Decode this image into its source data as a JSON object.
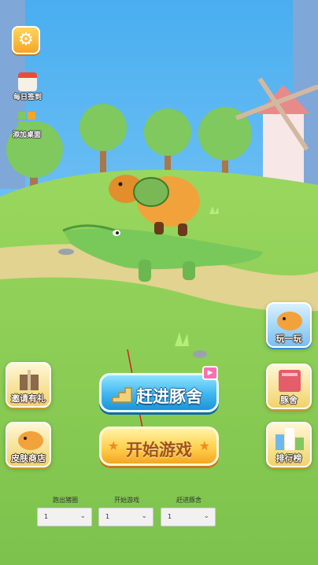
{
  "top_left": {
    "settings_icon": "gear-icon",
    "daily_checkin_label": "每日签到",
    "add_desktop_label": "添加桌面"
  },
  "right_buttons": {
    "play_label": "玩一玩",
    "pig_house_label": "豚舍",
    "leaderboard_label": "排行榜"
  },
  "left_buttons": {
    "invite_label": "邀请有礼",
    "skin_shop_label": "皮肤商店"
  },
  "center_buttons": {
    "enter_label": "赶进豚舍",
    "start_label": "开始游戏",
    "enter_badge_icon": "video-icon"
  },
  "selects": [
    {
      "caption": "跑出猪圈",
      "value": "1"
    },
    {
      "caption": "开始游戏",
      "value": "1"
    },
    {
      "caption": "赶进豚舍",
      "value": "1"
    }
  ],
  "colors": {
    "sky": "#4fb2f0",
    "grass": "#8fd05a",
    "path": "#e2d391",
    "accent_blue": "#3fb6f0",
    "accent_gold": "#ffd04d"
  }
}
